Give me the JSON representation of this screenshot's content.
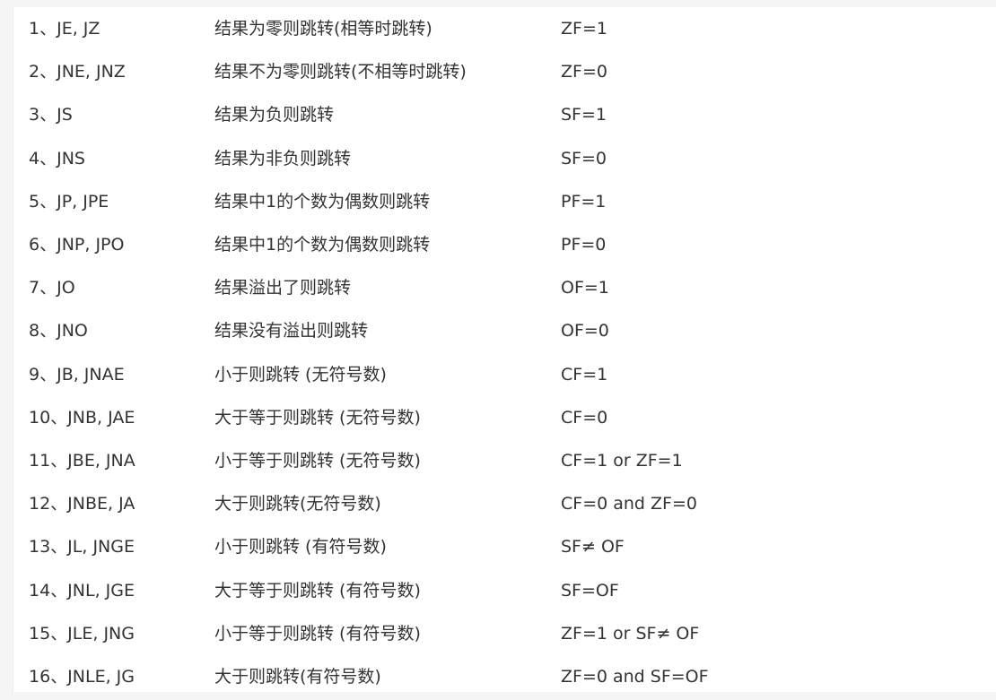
{
  "jumps": [
    {
      "instr": "1、JE, JZ",
      "desc": "结果为零则跳转(相等时跳转)",
      "flag": "ZF=1"
    },
    {
      "instr": "2、JNE, JNZ",
      "desc": "结果不为零则跳转(不相等时跳转)",
      "flag": "ZF=0"
    },
    {
      "instr": "3、JS",
      "desc": "结果为负则跳转",
      "flag": "SF=1"
    },
    {
      "instr": "4、JNS",
      "desc": "结果为非负则跳转",
      "flag": "SF=0"
    },
    {
      "instr": "5、JP, JPE",
      "desc": "结果中1的个数为偶数则跳转",
      "flag": "PF=1"
    },
    {
      "instr": "6、JNP, JPO",
      "desc": "结果中1的个数为偶数则跳转",
      "flag": "PF=0"
    },
    {
      "instr": "7、JO",
      "desc": "结果溢出了则跳转",
      "flag": "OF=1"
    },
    {
      "instr": "8、JNO",
      "desc": "结果没有溢出则跳转",
      "flag": "OF=0"
    },
    {
      "instr": "9、JB, JNAE",
      "desc": "小于则跳转 (无符号数)",
      "flag": "CF=1"
    },
    {
      "instr": "10、JNB, JAE",
      "desc": "大于等于则跳转 (无符号数)",
      "flag": "CF=0"
    },
    {
      "instr": "11、JBE, JNA",
      "desc": "小于等于则跳转 (无符号数)",
      "flag": "CF=1 or ZF=1"
    },
    {
      "instr": "12、JNBE, JA",
      "desc": "大于则跳转(无符号数)",
      "flag": "CF=0 and ZF=0"
    },
    {
      "instr": "13、JL, JNGE",
      "desc": "小于则跳转 (有符号数)",
      "flag": "SF≠ OF"
    },
    {
      "instr": "14、JNL, JGE",
      "desc": "大于等于则跳转 (有符号数)",
      "flag": "SF=OF"
    },
    {
      "instr": "15、JLE, JNG",
      "desc": "小于等于则跳转 (有符号数)",
      "flag": "ZF=1 or SF≠ OF"
    },
    {
      "instr": "16、JNLE, JG",
      "desc": "大于则跳转(有符号数)",
      "flag": "ZF=0 and SF=OF"
    }
  ]
}
